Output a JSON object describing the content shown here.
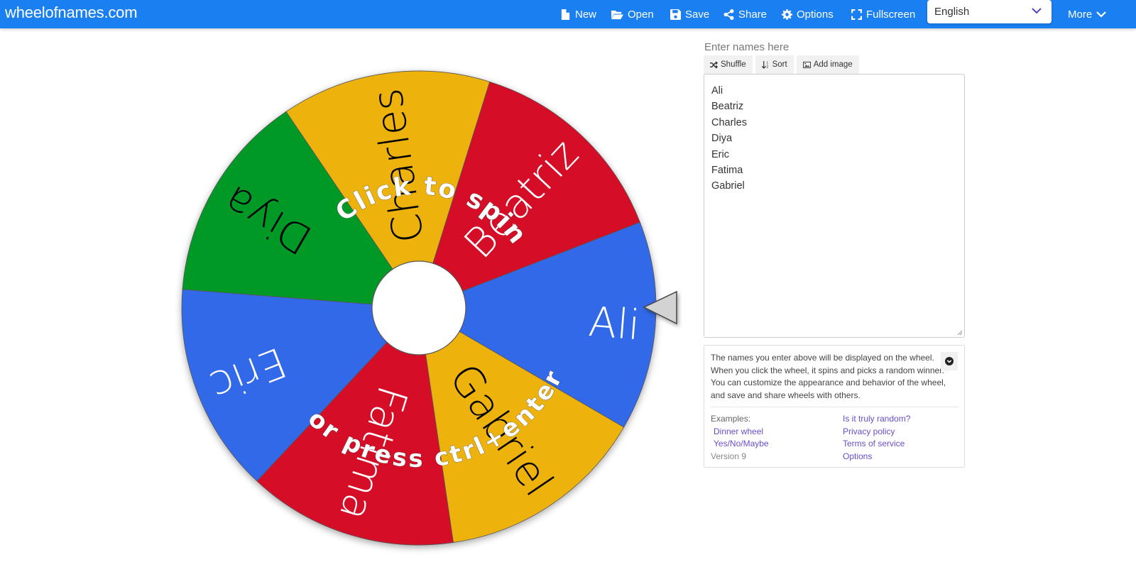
{
  "navbar": {
    "brand": "wheelofnames.com",
    "items": [
      {
        "label": "New",
        "icon": "file-icon"
      },
      {
        "label": "Open",
        "icon": "folder-open-icon"
      },
      {
        "label": "Save",
        "icon": "save-icon"
      },
      {
        "label": "Share",
        "icon": "share-icon"
      },
      {
        "label": "Options",
        "icon": "gear-icon"
      },
      {
        "label": "Fullscreen",
        "icon": "fullscreen-icon"
      }
    ],
    "language": "English",
    "more_label": "More"
  },
  "wheel": {
    "slices": [
      {
        "name": "Ali",
        "color": "#3369e8",
        "text_color": "#ffffff"
      },
      {
        "name": "Beatriz",
        "color": "#d50f25",
        "text_color": "#ffffff"
      },
      {
        "name": "Charles",
        "color": "#eeb211",
        "text_color": "#000000"
      },
      {
        "name": "Diya",
        "color": "#009925",
        "text_color": "#000000"
      },
      {
        "name": "Eric",
        "color": "#3369e8",
        "text_color": "#ffffff"
      },
      {
        "name": "Fatima",
        "color": "#d50f25",
        "text_color": "#ffffff"
      },
      {
        "name": "Gabriel",
        "color": "#eeb211",
        "text_color": "#000000"
      }
    ],
    "prompt_top": "Click to spin",
    "prompt_bottom": "or press ctrl+enter",
    "pointer_color": "#d3d3d3"
  },
  "panel": {
    "enter_label": "Enter names here",
    "tools": [
      {
        "label": "Shuffle",
        "icon": "shuffle-icon"
      },
      {
        "label": "Sort",
        "icon": "sort-icon"
      },
      {
        "label": "Add image",
        "icon": "image-icon"
      }
    ],
    "names": [
      "Ali",
      "Beatriz",
      "Charles",
      "Diya",
      "Eric",
      "Fatima",
      "Gabriel"
    ],
    "info_text": "The names you enter above will be displayed on the wheel. When you click the wheel, it spins and picks a random winner. You can customize the appearance and behavior of the wheel, and save and share wheels with others.",
    "examples_label": "Examples:",
    "example_links": [
      "Dinner wheel",
      "Yes/No/Maybe"
    ],
    "version": "Version 9",
    "right_links": [
      "Is it truly random?",
      "Privacy policy",
      "Terms of service",
      "Options"
    ]
  }
}
